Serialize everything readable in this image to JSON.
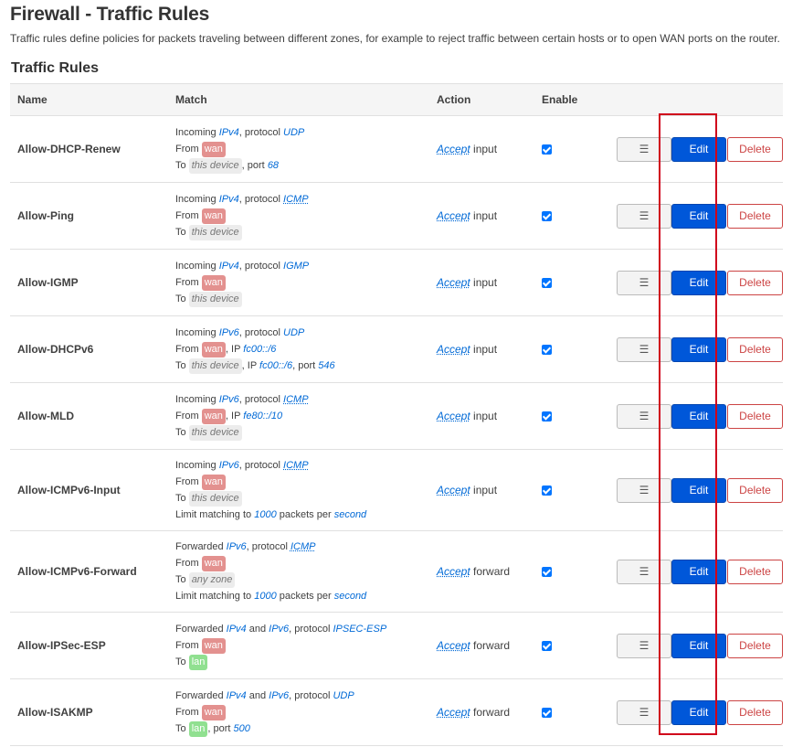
{
  "page": {
    "title": "Firewall - Traffic Rules",
    "description": "Traffic rules define policies for packets traveling between different zones, for example to reject traffic between certain hosts or to open WAN ports on the router.",
    "section_title": "Traffic Rules"
  },
  "table": {
    "headers": {
      "name": "Name",
      "match": "Match",
      "action": "Action",
      "enable": "Enable"
    },
    "buttons": {
      "drag": "☰",
      "edit": "Edit",
      "delete": "Delete"
    },
    "common": {
      "incoming": "Incoming",
      "forwarded": "Forwarded",
      "protocol": ", protocol",
      "and": "and",
      "from": "From",
      "to": "To",
      "ip": ", IP",
      "port": ", port",
      "limit": "Limit matching to",
      "packets_per": "packets per",
      "this_device": "this device",
      "any_zone": "any zone",
      "wan": "wan",
      "lan": "lan",
      "accept": "Accept",
      "input": "input",
      "forward": "forward"
    },
    "rows": [
      {
        "name": "Allow-DHCP-Renew",
        "family": "IPv4",
        "proto": "UDP",
        "to_port": "68"
      },
      {
        "name": "Allow-Ping",
        "family": "IPv4",
        "proto": "ICMP"
      },
      {
        "name": "Allow-IGMP",
        "family": "IPv4",
        "proto": "IGMP"
      },
      {
        "name": "Allow-DHCPv6",
        "family": "IPv6",
        "proto": "UDP",
        "from_ip": "fc00::/6",
        "to_ip": "fc00::/6",
        "to_port": "546"
      },
      {
        "name": "Allow-MLD",
        "family": "IPv6",
        "proto": "ICMP",
        "from_ip": "fe80::/10"
      },
      {
        "name": "Allow-ICMPv6-Input",
        "family": "IPv6",
        "proto": "ICMP",
        "limit": "1000",
        "limit_unit": "second"
      },
      {
        "name": "Allow-ICMPv6-Forward",
        "family": "IPv6",
        "proto": "ICMP",
        "limit": "1000",
        "limit_unit": "second"
      },
      {
        "name": "Allow-IPSec-ESP",
        "family": "IPv4",
        "family2": "IPv6",
        "proto": "IPSEC-ESP"
      },
      {
        "name": "Allow-ISAKMP",
        "family": "IPv4",
        "family2": "IPv6",
        "proto": "UDP",
        "to_port": "500"
      }
    ]
  },
  "colors": {
    "highlight": "#d0021b",
    "edit_button": "#0057d9",
    "delete_border": "#cc4444",
    "link": "#0069d6",
    "zone_wan": "#e3918f",
    "zone_lan": "#90e090"
  }
}
